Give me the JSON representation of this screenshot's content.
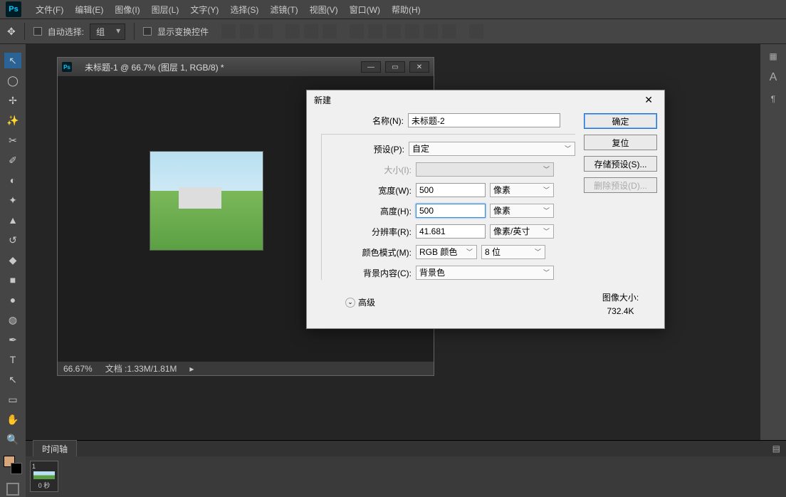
{
  "menubar": {
    "items": [
      "文件(F)",
      "编辑(E)",
      "图像(I)",
      "图层(L)",
      "文字(Y)",
      "选择(S)",
      "滤镜(T)",
      "视图(V)",
      "窗口(W)",
      "帮助(H)"
    ]
  },
  "options": {
    "autoSelectLabel": "自动选择:",
    "groupCombo": "组",
    "showTransformLabel": "显示变换控件"
  },
  "doc": {
    "title": "未标题-1 @ 66.7% (图层 1, RGB/8) *",
    "zoom": "66.67%",
    "docsize": "文档 :1.33M/1.81M"
  },
  "dialog": {
    "title": "新建",
    "labels": {
      "name": "名称(N):",
      "preset": "预设(P):",
      "size": "大小(I):",
      "width": "宽度(W):",
      "height": "高度(H):",
      "res": "分辨率(R):",
      "mode": "颜色模式(M):",
      "bg": "背景内容(C):",
      "adv": "高级"
    },
    "values": {
      "name": "未标题-2",
      "preset": "自定",
      "width": "500",
      "height": "500",
      "res": "41.681",
      "mode": "RGB 颜色",
      "bits": "8 位",
      "bg": "背景色"
    },
    "units": {
      "px": "像素",
      "resUnit": "像素/英寸"
    },
    "buttons": {
      "ok": "确定",
      "cancel": "复位",
      "save": "存储预设(S)...",
      "delete": "删除预设(D)..."
    },
    "sizeInfo": {
      "label": "图像大小:",
      "value": "732.4K"
    }
  },
  "timeline": {
    "tab": "时间轴",
    "frameNum": "1",
    "frameTime": "0 秒"
  },
  "tools": [
    "↖",
    "◯",
    "✢",
    "✎",
    "✂",
    "✐",
    "◐",
    "✦",
    "◑",
    "△",
    "✒",
    "◆",
    "●",
    "◍",
    "✎",
    "T",
    "↖",
    "⬚",
    "✋",
    "🔍"
  ]
}
